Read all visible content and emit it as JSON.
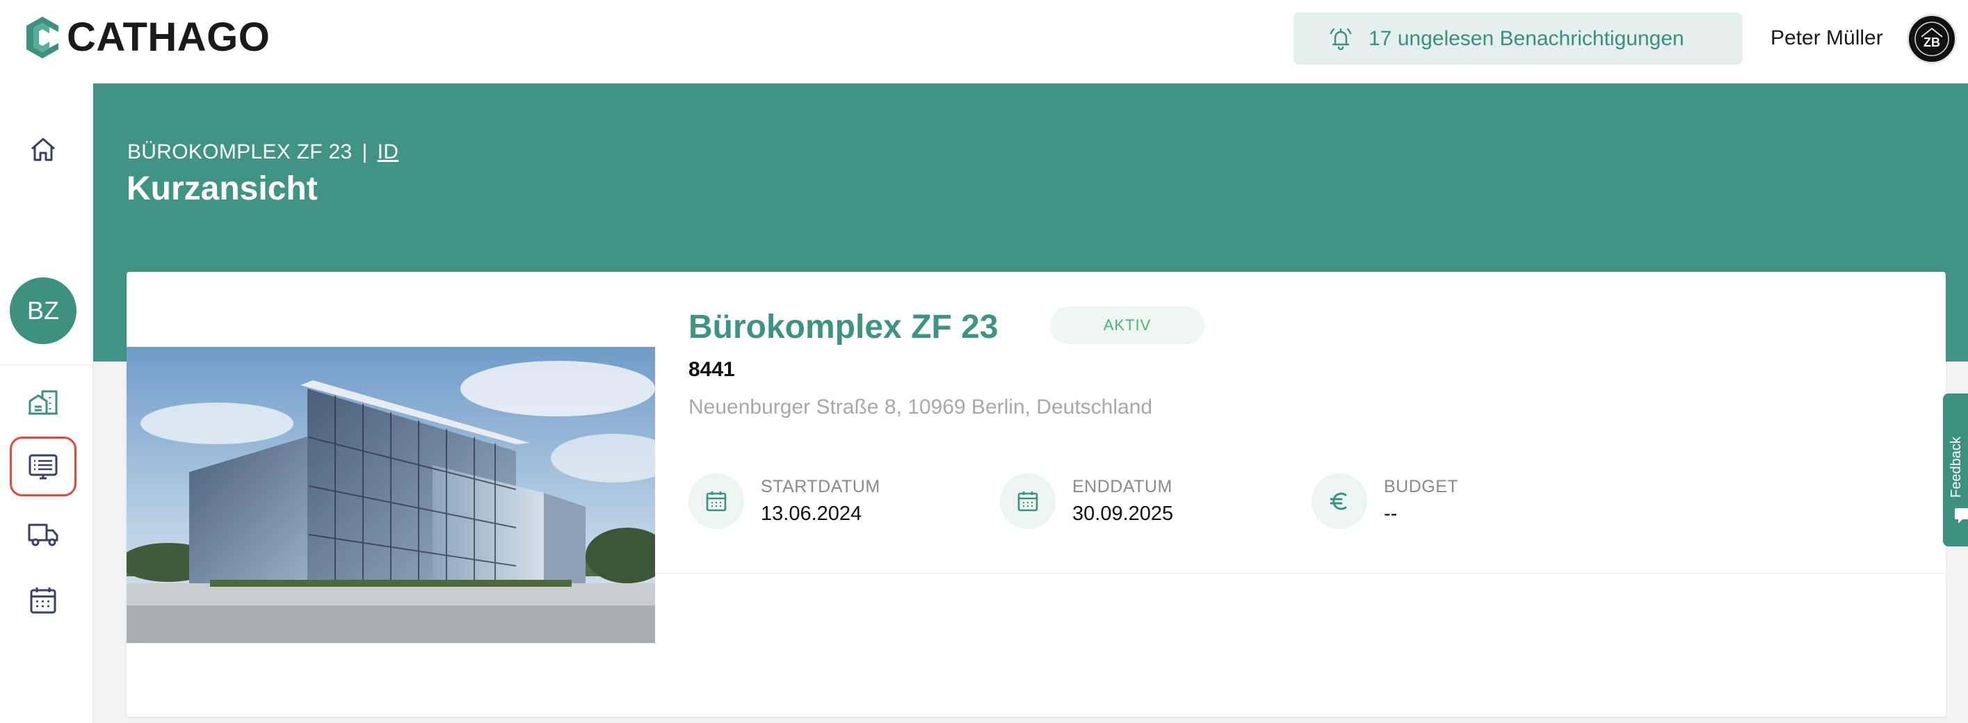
{
  "app": {
    "brand": "CATHAGO"
  },
  "header": {
    "notifications_label": "17 ungelesen Benachrichtigungen",
    "user_name": "Peter Müller",
    "avatar_initials": "ZB"
  },
  "sidebar": {
    "project_initials": "BZ",
    "items": [
      {
        "name": "home",
        "icon": "home-icon"
      },
      {
        "name": "buildings",
        "icon": "buildings-icon"
      },
      {
        "name": "list",
        "icon": "list-icon",
        "selected": true
      },
      {
        "name": "delivery",
        "icon": "truck-icon"
      },
      {
        "name": "calendar",
        "icon": "calendar-icon"
      }
    ]
  },
  "breadcrumb": {
    "project": "BÜROKOMPLEX ZF 23",
    "separator": "|",
    "link": "ID"
  },
  "page": {
    "title": "Kurzansicht"
  },
  "project": {
    "name": "Bürokomplex ZF 23",
    "status": "AKTIV",
    "number": "8441",
    "address": "Neuenburger Straße 8, 10969 Berlin, Deutschland",
    "start_label": "STARTDATUM",
    "start_value": "13.06.2024",
    "end_label": "ENDDATUM",
    "end_value": "30.09.2025",
    "budget_label": "BUDGET",
    "budget_value": "--"
  },
  "feedback": {
    "label": "Feedback"
  },
  "colors": {
    "primary": "#419384",
    "primary_dark": "#3e907f",
    "notification_bg": "#e5f0ee",
    "status_badge_text": "#4db17a",
    "selection_outline": "#e2483d"
  }
}
